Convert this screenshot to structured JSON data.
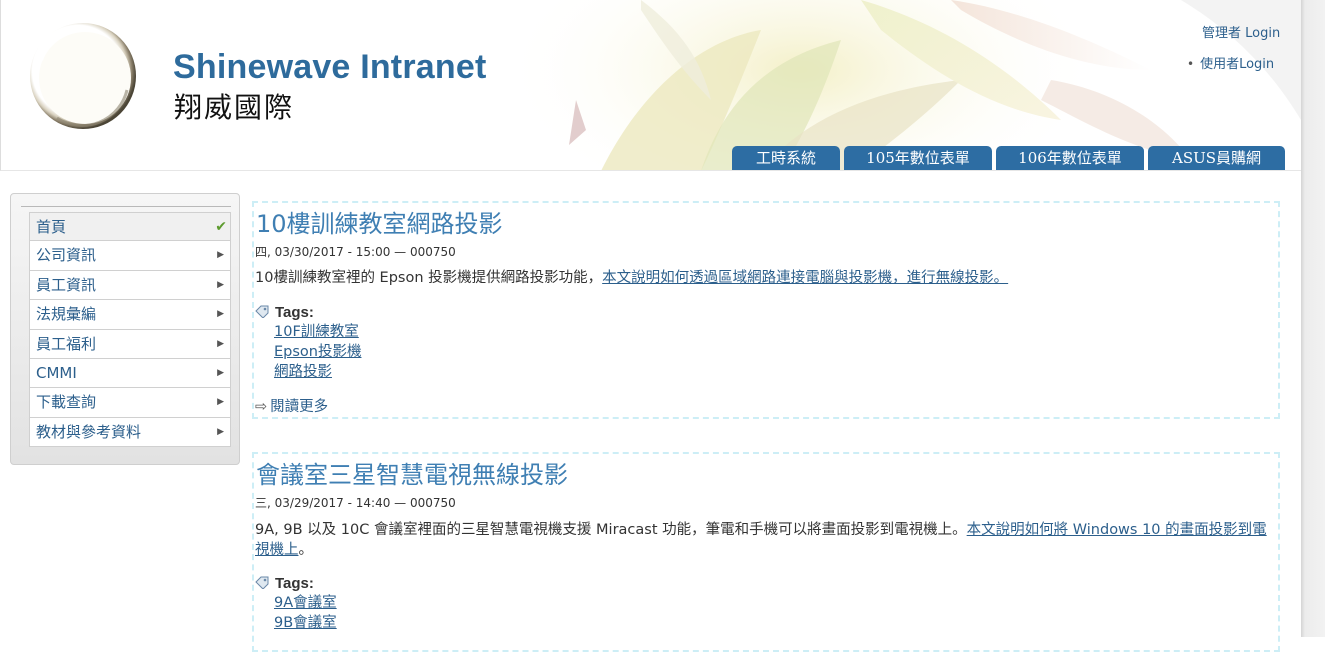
{
  "header": {
    "title": "Shinewave Intranet",
    "subtitle": "翔威國際",
    "admin_login": "管理者 Login",
    "user_login": "使用者Login",
    "bullet": "•"
  },
  "tabs": [
    {
      "label": "工時系統"
    },
    {
      "label": "105年數位表單"
    },
    {
      "label": "106年數位表單"
    },
    {
      "label": "ASUS員購網"
    }
  ],
  "sidebar": {
    "items": [
      {
        "label": "首頁",
        "icon": "check-icon",
        "active": true
      },
      {
        "label": "公司資訊",
        "icon": "triangle-right-icon"
      },
      {
        "label": "員工資訊",
        "icon": "triangle-right-icon"
      },
      {
        "label": "法規彙編",
        "icon": "triangle-right-icon"
      },
      {
        "label": "員工福利",
        "icon": "triangle-right-icon"
      },
      {
        "label": "CMMI",
        "icon": "triangle-right-icon"
      },
      {
        "label": "下載查詢",
        "icon": "triangle-right-icon"
      },
      {
        "label": "教材與參考資料",
        "icon": "triangle-right-icon"
      }
    ]
  },
  "articles": [
    {
      "title": "10樓訓練教室網路投影",
      "meta": "四, 03/30/2017 - 15:00 — 000750",
      "summary_text": "10樓訓練教室裡的 Epson 投影機提供網路投影功能，",
      "summary_link": "本文說明如何透過區域網路連接電腦與投影機，進行無線投影。",
      "summary_tail": "",
      "tags_label": "Tags:",
      "tags": [
        "10F訓練教室",
        "Epson投影機",
        "網路投影"
      ],
      "read_more": "閱讀更多"
    },
    {
      "title": "會議室三星智慧電視無線投影",
      "meta": "三, 03/29/2017 - 14:40 — 000750",
      "summary_text": "9A, 9B 以及 10C 會議室裡面的三星智慧電視機支援 Miracast 功能，筆電和手機可以將畫面投影到電視機上。",
      "summary_link": "本文說明如何將 Windows 10 的畫面投影到電視機上",
      "summary_tail": "。",
      "tags_label": "Tags:",
      "tags": [
        "9A會議室",
        "9B會議室"
      ]
    }
  ],
  "colors": {
    "brand_blue": "#2e6b9c",
    "tab_blue": "#2d6da3",
    "link": "#2c5f8c",
    "title_blue": "#3f7fb3",
    "dashed_border": "#cdeef6"
  }
}
